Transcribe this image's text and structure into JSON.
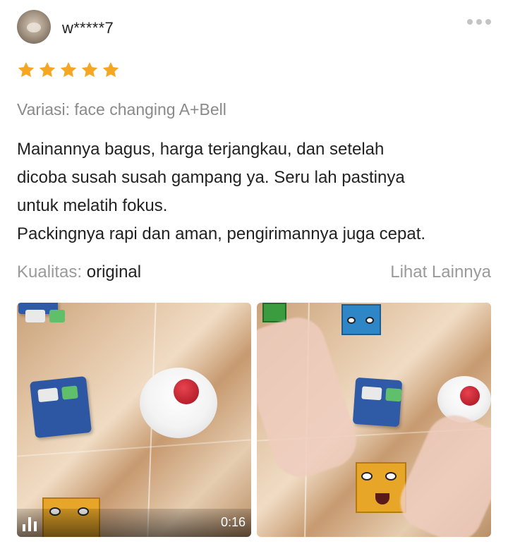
{
  "review": {
    "username": "w*****7",
    "rating": 5,
    "star_color": "#F5A623",
    "variation": "Variasi: face changing A+Bell",
    "body_lines": [
      "Mainannya bagus, harga terjangkau, dan setelah",
      "dicoba susah susah gampang ya. Seru lah pastinya",
      "untuk melatih fokus.",
      "Packingnya rapi dan aman, pengirimannya juga cepat."
    ],
    "quality_label": "Kualitas:",
    "quality_value": "original",
    "see_more": "Lihat Lainnya",
    "media": [
      {
        "type": "video",
        "duration": "0:16",
        "icon": "video-bars-icon"
      },
      {
        "type": "photo"
      }
    ],
    "icons": [
      "avatar",
      "more-dots-icon",
      "star-icon",
      "video-bars-icon"
    ]
  }
}
